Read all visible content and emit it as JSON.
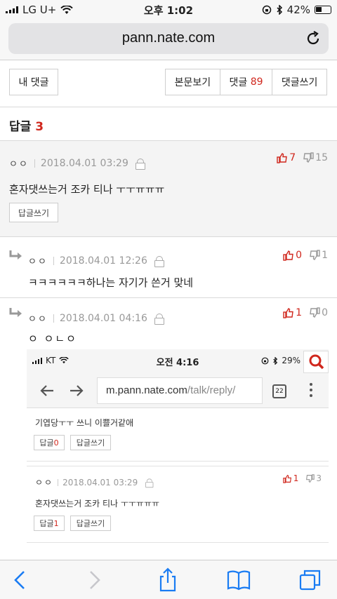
{
  "status_bar": {
    "carrier": "LG U+",
    "time": "오후 1:02",
    "battery": "42%",
    "battery_level": 0.42
  },
  "browser": {
    "url": "pann.nate.com"
  },
  "tabs": {
    "my_comments": "내 댓글",
    "view_post": "본문보기",
    "comments_label": "댓글",
    "comments_count": "89",
    "write_comment": "댓글쓰기"
  },
  "replies": {
    "label": "답글",
    "count": "3"
  },
  "main_comment": {
    "nick": "ㅇㅇ",
    "date": "2018.04.01 03:29",
    "up": "7",
    "down": "15",
    "text": "혼자댓쓰는거 조카 티나 ㅜㅜㅠㅠㅠ",
    "reply_button": "답글쓰기"
  },
  "reply1": {
    "nick": "ㅇㅇ",
    "date": "2018.04.01 12:26",
    "up": "0",
    "down": "1",
    "text": "ㅋㅋㅋㅋㅋㅋ하나는 자기가 쓴거 맞네"
  },
  "reply2": {
    "nick": "ㅇㅇ",
    "date": "2018.04.01 04:16",
    "up": "1",
    "down": "0",
    "text": "ㅇ ㅇㄴㅇ"
  },
  "embedded": {
    "carrier": "KT",
    "time": "오전 4:16",
    "battery": "29%",
    "url_host": "m.pann.nate.com",
    "url_path": "/talk/reply/",
    "tab_count": "22",
    "comment_text": "기엽당ㅜㅜ 쓰니 이쁠거같애",
    "reply_label": "답글",
    "reply_count_a": "0",
    "write_label": "답글쓰기",
    "nick": "ㅇㅇ",
    "date": "2018.04.01 03:29",
    "up": "1",
    "down": "3",
    "text2": "혼자댓쓰는거 조카 티나 ㅜㅜㅠㅠㅠ",
    "reply_count_b": "1"
  },
  "colors": {
    "accent_red": "#d0271d",
    "ios_blue": "#1a7cf3"
  }
}
